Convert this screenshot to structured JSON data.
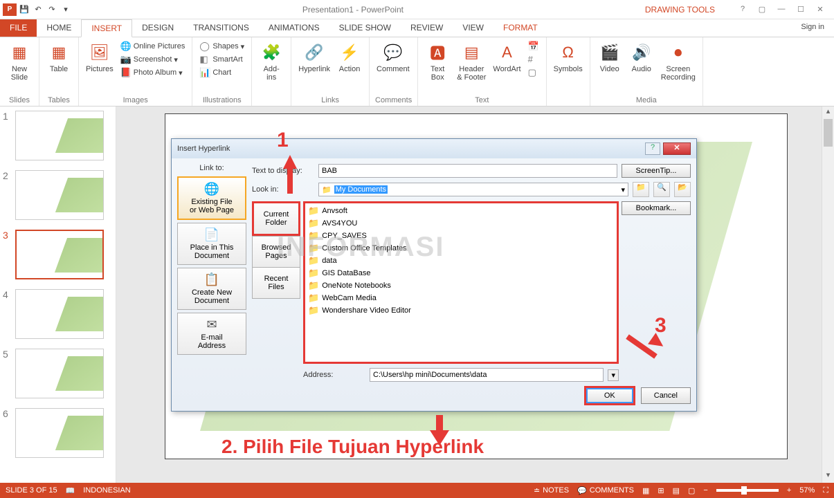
{
  "app": {
    "title": "Presentation1 - PowerPoint",
    "context_tab": "DRAWING TOOLS",
    "signin": "Sign in"
  },
  "tabs": {
    "file": "FILE",
    "home": "HOME",
    "insert": "INSERT",
    "design": "DESIGN",
    "transitions": "TRANSITIONS",
    "animations": "ANIMATIONS",
    "slideshow": "SLIDE SHOW",
    "review": "REVIEW",
    "view": "VIEW",
    "format": "FORMAT"
  },
  "ribbon": {
    "slides": {
      "label": "Slides",
      "new_slide": "New\nSlide"
    },
    "tables": {
      "label": "Tables",
      "table": "Table"
    },
    "images": {
      "label": "Images",
      "pictures": "Pictures",
      "online": "Online Pictures",
      "screenshot": "Screenshot",
      "album": "Photo Album"
    },
    "illustrations": {
      "label": "Illustrations",
      "shapes": "Shapes",
      "smartart": "SmartArt",
      "chart": "Chart"
    },
    "addins": {
      "addins": "Add-\nins"
    },
    "links": {
      "label": "Links",
      "hyperlink": "Hyperlink",
      "action": "Action"
    },
    "comments": {
      "label": "Comments",
      "comment": "Comment"
    },
    "text": {
      "label": "Text",
      "textbox": "Text\nBox",
      "header": "Header\n& Footer",
      "wordart": "WordArt"
    },
    "symbols": {
      "symbols": "Symbols"
    },
    "media": {
      "label": "Media",
      "video": "Video",
      "audio": "Audio",
      "screen": "Screen\nRecording"
    }
  },
  "dialog": {
    "title": "Insert Hyperlink",
    "linkto": "Link to:",
    "text_display": "Text to display:",
    "text_value": "BAB",
    "screentip": "ScreenTip...",
    "lookin": "Look in:",
    "lookin_value": "My Documents",
    "bookmark": "Bookmark...",
    "address": "Address:",
    "address_value": "C:\\Users\\hp mini\\Documents\\data",
    "ok": "OK",
    "cancel": "Cancel",
    "linkto_opts": {
      "existing": "Existing File\nor Web Page",
      "place": "Place in This\nDocument",
      "create": "Create New\nDocument",
      "email": "E-mail\nAddress"
    },
    "browse_opts": {
      "current": "Current\nFolder",
      "browsed": "Browsed\nPages",
      "recent": "Recent\nFiles"
    },
    "files": [
      "Anvsoft",
      "AVS4YOU",
      "CPY_SAVES",
      "Custom Office Templates",
      "data",
      "GIS DataBase",
      "OneNote Notebooks",
      "WebCam Media",
      "Wondershare Video Editor"
    ]
  },
  "status": {
    "slide": "SLIDE 3 OF 15",
    "lang": "INDONESIAN",
    "notes": "NOTES",
    "comments": "COMMENTS",
    "zoom": "57%"
  },
  "annotations": {
    "a1": "1",
    "a3": "3",
    "a2": "2. Pilih File Tujuan Hyperlink"
  },
  "watermark": "INFORMASI"
}
